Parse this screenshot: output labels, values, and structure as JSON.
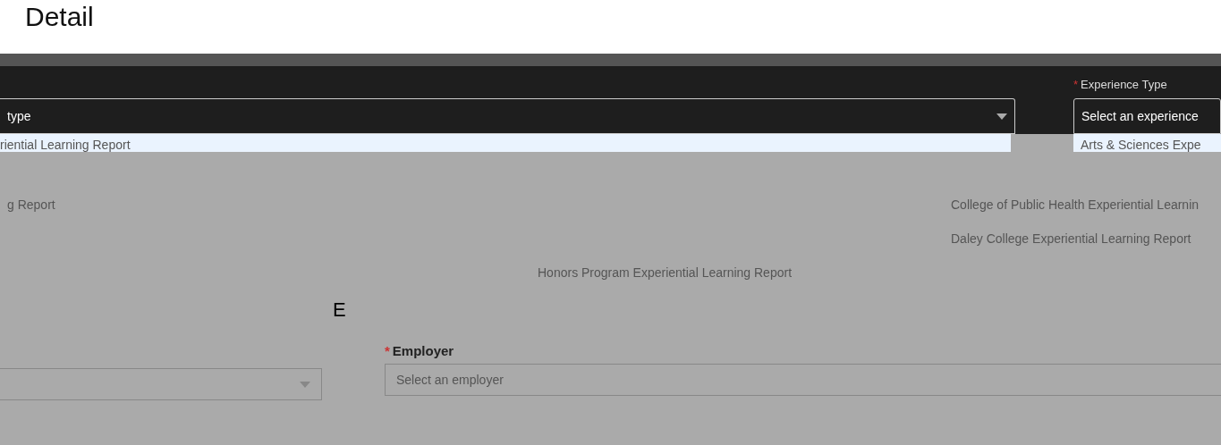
{
  "heading": "Detail",
  "left_select": {
    "value": "type"
  },
  "left_options": [
    {
      "label": "riential Learning Report",
      "selected": true
    },
    {
      "label": "g Report",
      "selected": false
    }
  ],
  "experience_type": {
    "label": "Experience Type",
    "required_mark": "*",
    "value": "Select an experience"
  },
  "right_options": [
    {
      "label": "Arts & Sciences Expe",
      "selected": true
    },
    {
      "label": "College of Public Health Experiential Learnin",
      "selected": false
    },
    {
      "label": "Daley College Experiential Learning Report",
      "selected": false
    },
    {
      "label": "Honors Program Experiential Learning Report",
      "selected": false
    }
  ],
  "letter": "E",
  "employer": {
    "label": "Employer",
    "required_mark": "*",
    "placeholder": "Select an employer"
  }
}
